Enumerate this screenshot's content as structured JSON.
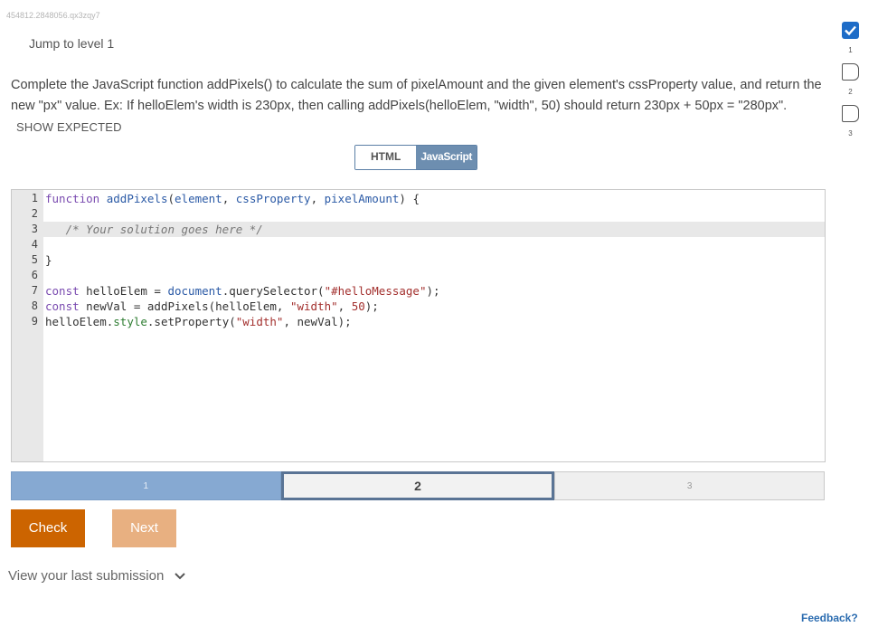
{
  "session_id": "454812.2848056.qx3zqy7",
  "jump_link": "Jump to level 1",
  "prompt": {
    "text": "Complete the JavaScript function addPixels() to calculate the sum of pixelAmount and the given element's cssProperty value, and return the new \"px\" value. Ex: If helloElem's width is 230px, then calling addPixels(helloElem, \"width\", 50) should return 230px + 50px = \"280px\".",
    "show_expected": "SHOW EXPECTED"
  },
  "lang_tabs": {
    "html": "HTML",
    "javascript": "JavaScript",
    "selected": "JavaScript"
  },
  "editor": {
    "line_numbers": [
      "1",
      "2",
      "3",
      "4",
      "5",
      "6",
      "7",
      "8",
      "9"
    ],
    "active_line": 3
  },
  "progress": {
    "segments": [
      "1",
      "2",
      "3"
    ],
    "current": 2
  },
  "buttons": {
    "check": "Check",
    "next": "Next"
  },
  "last_submission": "View your last submission",
  "feedback": "Feedback?",
  "levels": [
    {
      "number": "1",
      "completed": true
    },
    {
      "number": "2",
      "completed": false
    },
    {
      "number": "3",
      "completed": false
    }
  ],
  "colors": {
    "accent_blue": "#1e6cc7",
    "check_orange": "#cc6400",
    "next_orange": "#e8b081",
    "progress_done": "#86a9d2"
  }
}
